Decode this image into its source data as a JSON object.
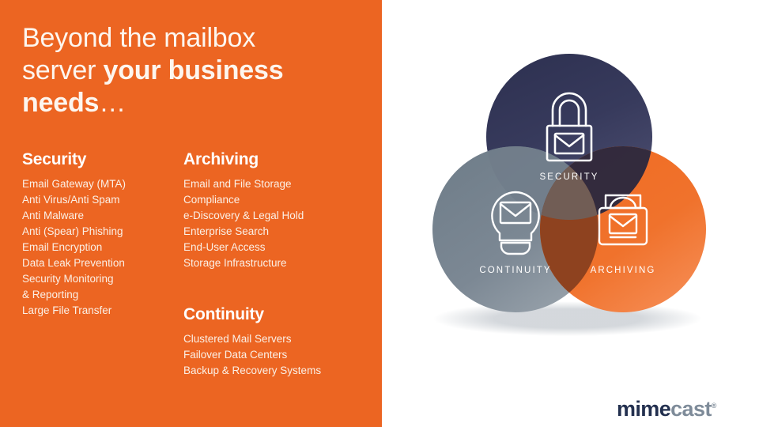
{
  "slide": {
    "background_color": "#ffffff",
    "panel_color": "#ec6522"
  },
  "title": {
    "line1": "Beyond the mailbox",
    "line2_plain": "server ",
    "line2_bold": "your business",
    "line3_bold": "needs",
    "line3_dots": "…"
  },
  "columns": {
    "security": {
      "heading": "Security",
      "items": [
        "Email Gateway (MTA)",
        "Anti Virus/Anti Spam",
        "Anti Malware",
        "Anti (Spear) Phishing",
        "Email Encryption",
        "Data Leak Prevention",
        "Security Monitoring\n& Reporting",
        "Large File Transfer"
      ]
    },
    "archiving": {
      "heading": "Archiving",
      "items": [
        "Email and File Storage",
        "Compliance",
        "e-Discovery & Legal Hold",
        "Enterprise Search",
        "End-User Access",
        "Storage Infrastructure"
      ]
    },
    "continuity": {
      "heading": "Continuity",
      "items": [
        "Clustered Mail Servers",
        "Failover Data Centers",
        "Backup & Recovery Systems"
      ]
    }
  },
  "venn": {
    "security": {
      "label": "SECURITY",
      "color": "#2b2d4f",
      "icon": "padlock-envelope-icon"
    },
    "continuity": {
      "label": "CONTINUITY",
      "color": "#74818c",
      "icon": "lightbulb-envelope-icon"
    },
    "archiving": {
      "label": "ARCHIVING",
      "color": "#ec6522",
      "icon": "archive-box-envelope-icon"
    }
  },
  "logo": {
    "part1": "mime",
    "part2": "cast",
    "registered": "®",
    "color1": "#23304f",
    "color2": "#7e8b99"
  }
}
